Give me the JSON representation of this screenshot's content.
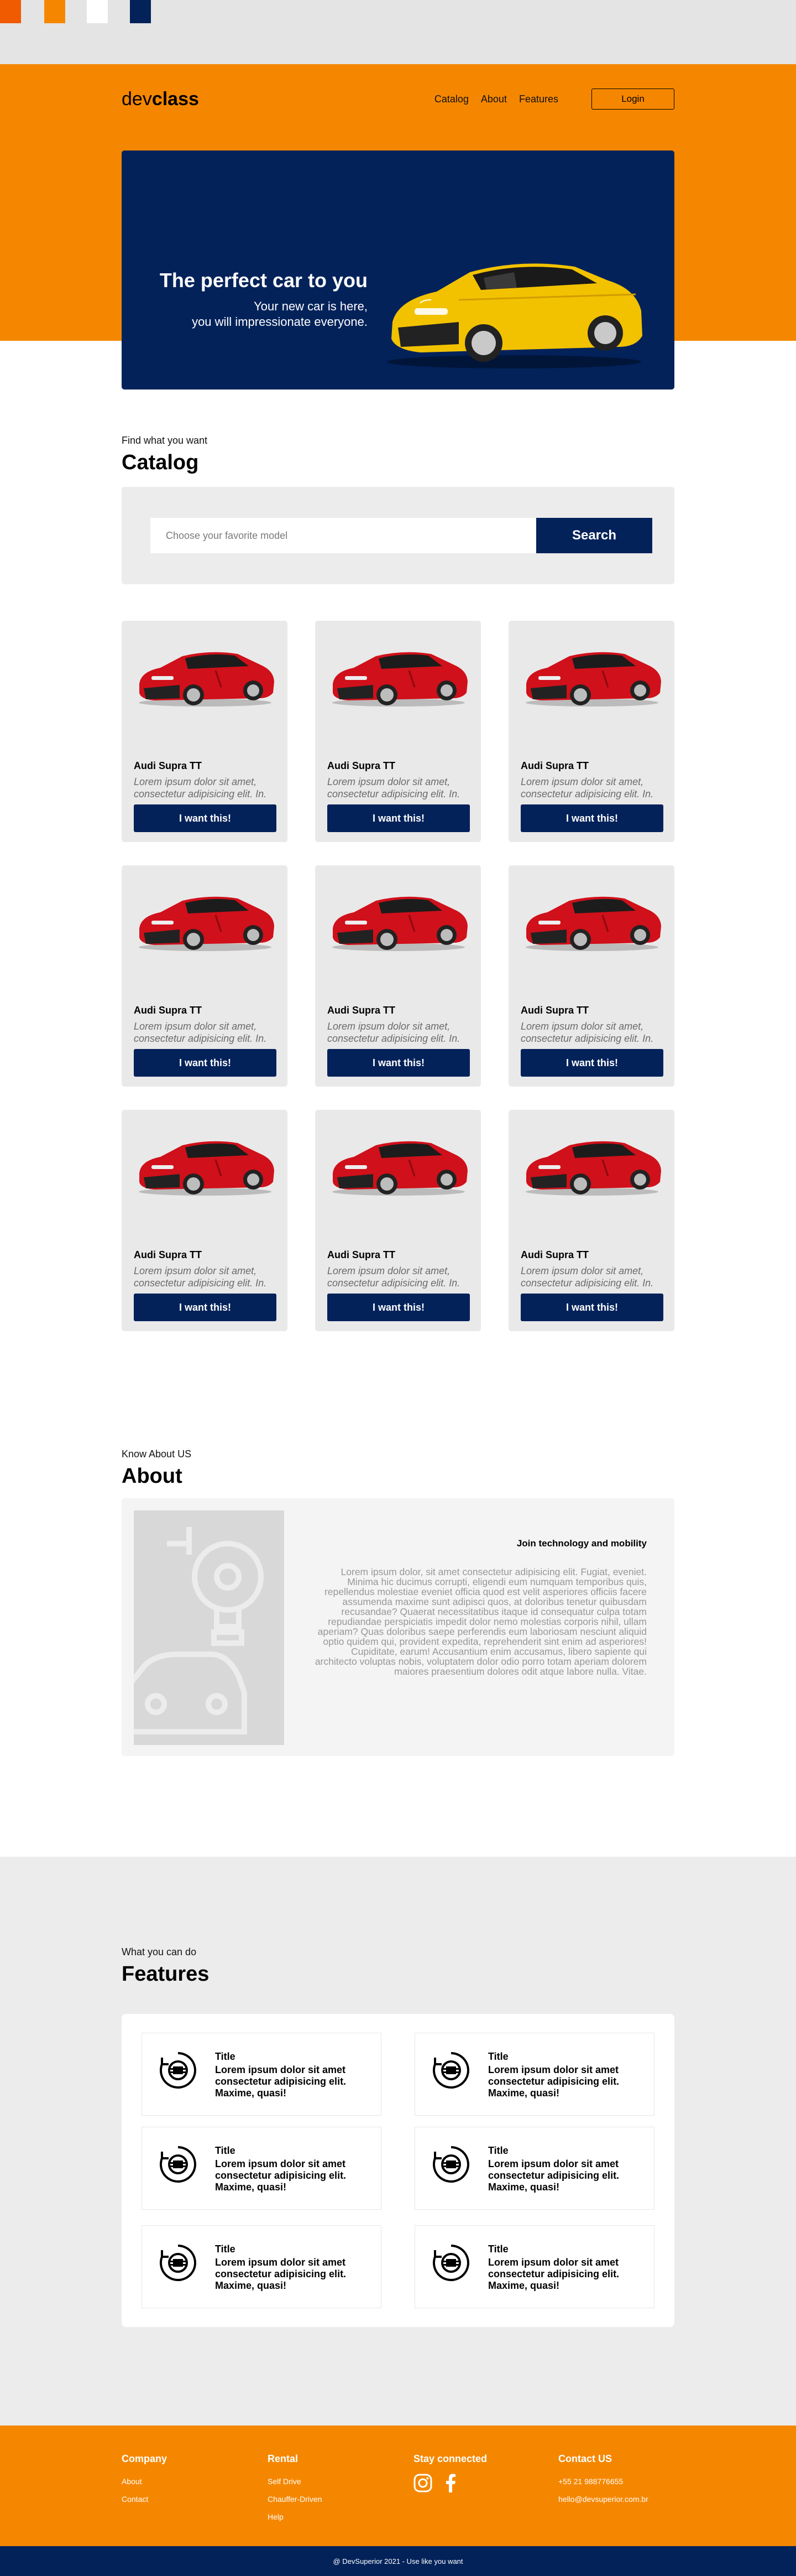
{
  "palette": {
    "colors": [
      "#f05a00",
      "#f58700",
      "#ffffff",
      "#03225a"
    ]
  },
  "header": {
    "logo_light": "dev",
    "logo_bold": "class",
    "nav": [
      {
        "label": "Catalog"
      },
      {
        "label": "About"
      },
      {
        "label": "Features"
      }
    ],
    "login_label": "Login"
  },
  "hero": {
    "title": "The perfect car to you",
    "subtitle_line1": "Your new car is here,",
    "subtitle_line2": "you will impressionate everyone."
  },
  "catalog": {
    "eyebrow": "Find what you want",
    "title": "Catalog",
    "search_placeholder": "Choose your favorite model",
    "search_button": "Search",
    "cars": [
      {
        "name": "Audi Supra TT",
        "description": "Lorem ipsum dolor sit amet, consectetur adipisicing elit. In.",
        "button": "I want this!"
      },
      {
        "name": "Audi Supra TT",
        "description": "Lorem ipsum dolor sit amet, consectetur adipisicing elit. In.",
        "button": "I want this!"
      },
      {
        "name": "Audi Supra TT",
        "description": "Lorem ipsum dolor sit amet, consectetur adipisicing elit. In.",
        "button": "I want this!"
      },
      {
        "name": "Audi Supra TT",
        "description": "Lorem ipsum dolor sit amet, consectetur adipisicing elit. In.",
        "button": "I want this!"
      },
      {
        "name": "Audi Supra TT",
        "description": "Lorem ipsum dolor sit amet, consectetur adipisicing elit. In.",
        "button": "I want this!"
      },
      {
        "name": "Audi Supra TT",
        "description": "Lorem ipsum dolor sit amet, consectetur adipisicing elit. In.",
        "button": "I want this!"
      },
      {
        "name": "Audi Supra TT",
        "description": "Lorem ipsum dolor sit amet, consectetur adipisicing elit. In.",
        "button": "I want this!"
      },
      {
        "name": "Audi Supra TT",
        "description": "Lorem ipsum dolor sit amet, consectetur adipisicing elit. In.",
        "button": "I want this!"
      },
      {
        "name": "Audi Supra TT",
        "description": "Lorem ipsum dolor sit amet, consectetur adipisicing elit. In.",
        "button": "I want this!"
      }
    ]
  },
  "about": {
    "eyebrow": "Know About US",
    "title": "About",
    "heading": "Join technology and mobility",
    "text": "Lorem ipsum dolor, sit amet consectetur adipisicing elit. Fugiat, eveniet. Minima hic ducimus corrupti, eligendi eum numquam temporibus quis, repellendus molestiae eveniet officia quod est velit asperiores officiis facere assumenda maxime sunt adipisci quos, at doloribus tenetur quibusdam recusandae? Quaerat necessitatibus itaque id consequatur culpa totam repudiandae perspiciatis impedit dolor nemo molestias corporis nihil, ullam aperiam? Quas doloribus saepe perferendis eum laboriosam nesciunt aliquid optio quidem qui, provident expedita, reprehenderit sint enim ad asperiores! Cupiditate, earum! Accusantium enim accusamus, libero sapiente qui architecto voluptas nobis, voluptatem dolor odio porro totam aperiam dolorem maiores praesentium dolores odit atque labore nulla. Vitae."
  },
  "features": {
    "eyebrow": "What you can do",
    "title": "Features",
    "items": [
      {
        "title": "Title",
        "text": "Lorem ipsum dolor sit amet consectetur adipisicing elit. Maxime, quasi!"
      },
      {
        "title": "Title",
        "text": "Lorem ipsum dolor sit amet consectetur adipisicing elit. Maxime, quasi!"
      },
      {
        "title": "Title",
        "text": "Lorem ipsum dolor sit amet consectetur adipisicing elit. Maxime, quasi!"
      },
      {
        "title": "Title",
        "text": "Lorem ipsum dolor sit amet consectetur adipisicing elit. Maxime, quasi!"
      },
      {
        "title": "Title",
        "text": "Lorem ipsum dolor sit amet consectetur adipisicing elit. Maxime, quasi!"
      },
      {
        "title": "Title",
        "text": "Lorem ipsum dolor sit amet consectetur adipisicing elit. Maxime, quasi!"
      }
    ]
  },
  "footer": {
    "company": {
      "title": "Company",
      "links": [
        "About",
        "Contact"
      ]
    },
    "rental": {
      "title": "Rental",
      "links": [
        "Self Drive",
        "Chauffer-Driven",
        "Help"
      ]
    },
    "stay": {
      "title": "Stay connected",
      "icons": [
        "instagram-icon",
        "facebook-icon"
      ]
    },
    "contact": {
      "title": "Contact US",
      "phone": "+55 21 988776655",
      "email": "hello@devsuperior.com.br"
    },
    "copyright": "@ DevSuperior 2021 - Use like you want"
  },
  "colors": {
    "orange": "#f58700",
    "navy": "#03225a",
    "car_yellow": "#f2c200",
    "car_red": "#d0101a"
  }
}
